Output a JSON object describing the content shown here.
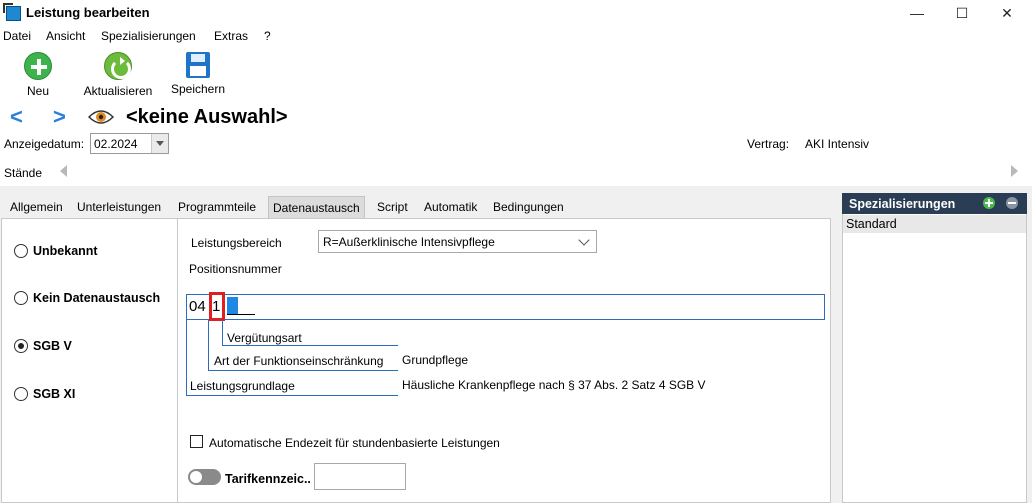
{
  "window": {
    "title": "Leistung bearbeiten",
    "minimize": "—",
    "maximize": "☐",
    "close": "✕"
  },
  "menu": [
    "Datei",
    "Ansicht",
    "Spezialisierungen",
    "Extras",
    "?"
  ],
  "toolbar": {
    "new_label": "Neu",
    "refresh_label": "Aktualisieren",
    "save_label": "Speichern"
  },
  "nav": {
    "back": "<",
    "forward": ">",
    "record_title": "<keine Auswahl>"
  },
  "display_date": {
    "label": "Anzeigedatum:",
    "value": "02.2024"
  },
  "contract": {
    "label": "Vertrag:",
    "value": "AKI Intensiv"
  },
  "staende": {
    "label": "Stände"
  },
  "tabs": [
    {
      "label": "Allgemein",
      "active": false
    },
    {
      "label": "Unterleistungen",
      "active": false
    },
    {
      "label": "Programmteile",
      "active": false
    },
    {
      "label": "Datenaustausch",
      "active": true
    },
    {
      "label": "Script",
      "active": false
    },
    {
      "label": "Automatik",
      "active": false
    },
    {
      "label": "Bedingungen",
      "active": false
    }
  ],
  "exchange_options": [
    {
      "label": "Unbekannt",
      "selected": false
    },
    {
      "label": "Kein Datenaustausch",
      "selected": false
    },
    {
      "label": "SGB V",
      "selected": true
    },
    {
      "label": "SGB XI",
      "selected": false
    }
  ],
  "form": {
    "leistungsbereich_label": "Leistungsbereich",
    "leistungsbereich_value": "R=Außerklinische Intensivpflege",
    "positionsnummer_label": "Positionsnummer",
    "positionsnummer_prefix": "04",
    "positionsnummer_digit": "1",
    "verguetungsart_label": "Vergütungsart",
    "funktionseinschraenkung_label": "Art der Funktionseinschränkung",
    "funktionseinschraenkung_value": "Grundpflege",
    "leistungsgrundlage_label": "Leistungsgrundlage",
    "leistungsgrundlage_value": "Häusliche Krankenpflege nach § 37 Abs. 2 Satz 4 SGB V",
    "auto_endzeit_label": "Automatische Endezeit für stundenbasierte Leistungen",
    "auto_endzeit_checked": false,
    "tarif_label": "Tarifkennzeic..",
    "tarif_on": false,
    "tarif_value": ""
  },
  "specializations": {
    "title": "Spezialisierungen",
    "items": [
      "Standard"
    ]
  }
}
